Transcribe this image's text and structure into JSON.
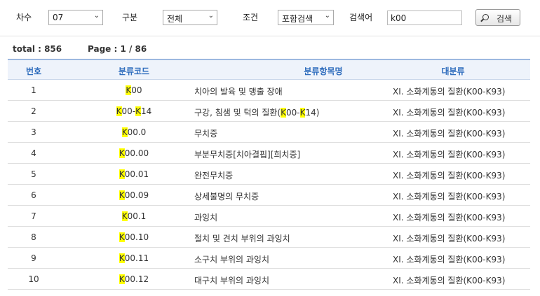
{
  "search": {
    "round_label": "차수",
    "round_value": "07",
    "type_label": "구분",
    "type_value": "전체",
    "cond_label": "조건",
    "cond_value": "포함검색",
    "keyword_label": "검색어",
    "keyword_value": "k00",
    "button_label": "검색"
  },
  "info": {
    "total": "total : 856",
    "page": "Page : 1 / 86"
  },
  "table": {
    "headers": [
      "번호",
      "분류코드",
      "분류항목명",
      "대분류"
    ],
    "rows": [
      {
        "no": "1",
        "code_hl": "K",
        "code_rest": "00",
        "name_pre": "치아의 발육 및 맹출 장애",
        "name_hl": "",
        "name_mid": "",
        "name_hl2": "",
        "name_post": "",
        "cat": "ⅩⅠ. 소화계통의 질환(K00-K93)"
      },
      {
        "no": "2",
        "code_hl": "K",
        "code_rest": "00-",
        "code_hl2": "K",
        "code_rest2": "14",
        "name_pre": "구강, 침샘 및 턱의 질환(",
        "name_hl": "K",
        "name_mid": "00-",
        "name_hl2": "K",
        "name_post": "14)",
        "cat": "ⅩⅠ. 소화계통의 질환(K00-K93)"
      },
      {
        "no": "3",
        "code_hl": "K",
        "code_rest": "00.0",
        "name_pre": "무치증",
        "cat": "ⅩⅠ. 소화계통의 질환(K00-K93)"
      },
      {
        "no": "4",
        "code_hl": "K",
        "code_rest": "00.00",
        "name_pre": "부분무치증[치아결핍][희치증]",
        "cat": "ⅩⅠ. 소화계통의 질환(K00-K93)"
      },
      {
        "no": "5",
        "code_hl": "K",
        "code_rest": "00.01",
        "name_pre": "완전무치증",
        "cat": "ⅩⅠ. 소화계통의 질환(K00-K93)"
      },
      {
        "no": "6",
        "code_hl": "K",
        "code_rest": "00.09",
        "name_pre": "상세불명의 무치증",
        "cat": "ⅩⅠ. 소화계통의 질환(K00-K93)"
      },
      {
        "no": "7",
        "code_hl": "K",
        "code_rest": "00.1",
        "name_pre": "과잉치",
        "cat": "ⅩⅠ. 소화계통의 질환(K00-K93)"
      },
      {
        "no": "8",
        "code_hl": "K",
        "code_rest": "00.10",
        "name_pre": "절치 및 견치 부위의 과잉치",
        "cat": "ⅩⅠ. 소화계통의 질환(K00-K93)"
      },
      {
        "no": "9",
        "code_hl": "K",
        "code_rest": "00.11",
        "name_pre": "소구치 부위의 과잉치",
        "cat": "ⅩⅠ. 소화계통의 질환(K00-K93)"
      },
      {
        "no": "10",
        "code_hl": "K",
        "code_rest": "00.12",
        "name_pre": "대구치 부위의 과잉치",
        "cat": "ⅩⅠ. 소화계통의 질환(K00-K93)"
      }
    ]
  }
}
